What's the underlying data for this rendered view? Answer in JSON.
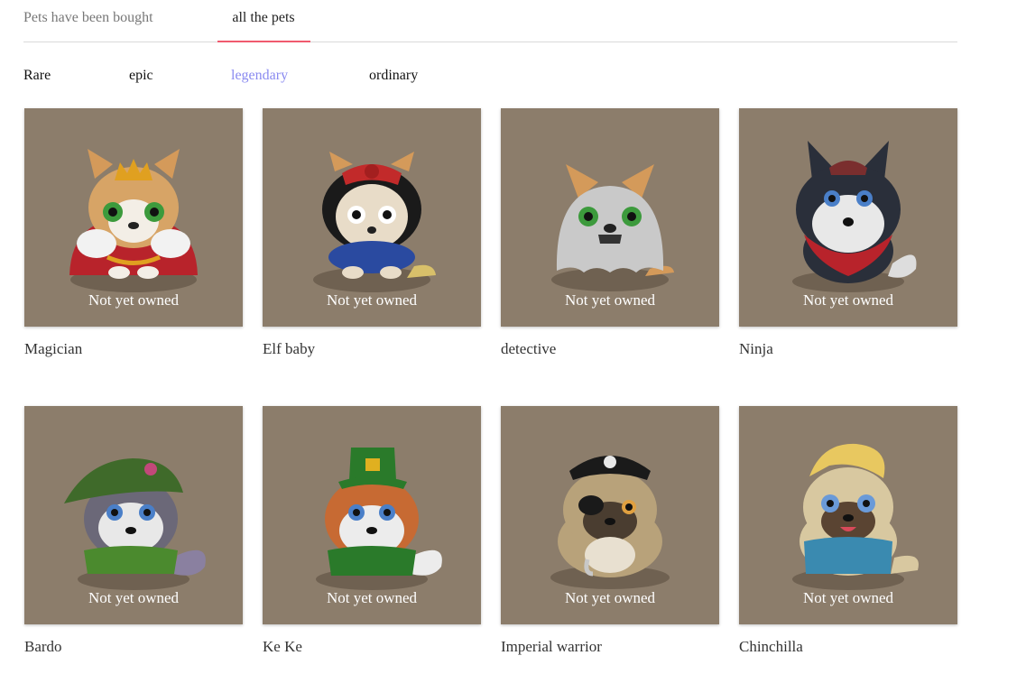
{
  "tabs": [
    {
      "label": "Pets have been bought"
    },
    {
      "label": "all the pets"
    }
  ],
  "filters": [
    {
      "label": "Rare"
    },
    {
      "label": "epic"
    },
    {
      "label": "legendary"
    },
    {
      "label": "ordinary"
    }
  ],
  "pets": [
    {
      "name": "Magician",
      "status": "Not yet owned"
    },
    {
      "name": "Elf baby",
      "status": "Not yet owned"
    },
    {
      "name": "detective",
      "status": "Not yet owned"
    },
    {
      "name": "Ninja",
      "status": "Not yet owned"
    },
    {
      "name": "Bardo",
      "status": "Not yet owned"
    },
    {
      "name": "Ke Ke",
      "status": "Not yet owned"
    },
    {
      "name": "Imperial warrior",
      "status": "Not yet owned"
    },
    {
      "name": "Chinchilla",
      "status": "Not yet owned"
    }
  ],
  "colors": {
    "card_bg": "#8c7d6b",
    "active_filter": "#8a8af0",
    "tab_underline": "#f05a6e"
  }
}
